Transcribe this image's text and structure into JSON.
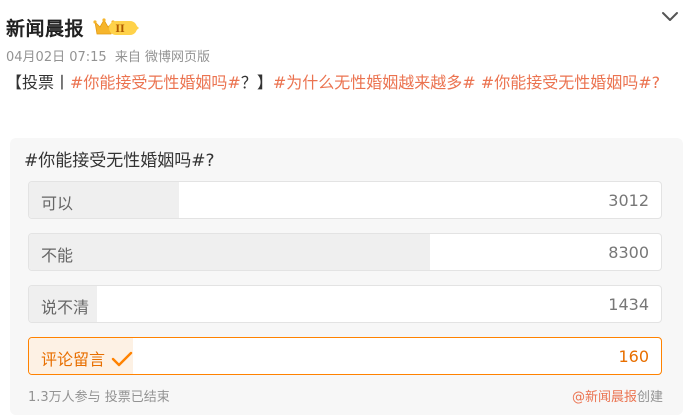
{
  "post": {
    "author": "新闻晨报",
    "badge_text": "II",
    "date": "04月02日 07:15",
    "source": "来自 微博网页版",
    "content_segments": [
      {
        "text": "【投票丨",
        "type": "plain"
      },
      {
        "text": "#你能接受无性婚姻吗#",
        "type": "topic"
      },
      {
        "text": "？】",
        "type": "plain"
      },
      {
        "text": "#为什么无性婚姻越来越多#",
        "type": "topic"
      },
      {
        "text": " ",
        "type": "plain"
      },
      {
        "text": "#你能接受无性婚姻吗#",
        "type": "topic"
      },
      {
        "text": "?",
        "type": "topic"
      }
    ]
  },
  "poll": {
    "title": "#你能接受无性婚姻吗#?",
    "options": [
      {
        "label": "可以",
        "count": "3012",
        "share": 0.237,
        "selected": false
      },
      {
        "label": "不能",
        "count": "8300",
        "share": 0.635,
        "selected": false
      },
      {
        "label": "说不清",
        "count": "1434",
        "share": 0.108,
        "selected": false
      },
      {
        "label": "评论留言",
        "count": "160",
        "share": 0.165,
        "selected": true
      }
    ],
    "participants": "1.3万人参与 投票已结束",
    "creator": "@新闻晨报",
    "created_label": "创建"
  },
  "colors": {
    "accent": "#eb7350",
    "selected_border": "#ff8200",
    "badge_gold": "#f6c344"
  },
  "icons": [
    "vip-badge-icon",
    "chevron-down-icon",
    "checkmark-icon"
  ]
}
